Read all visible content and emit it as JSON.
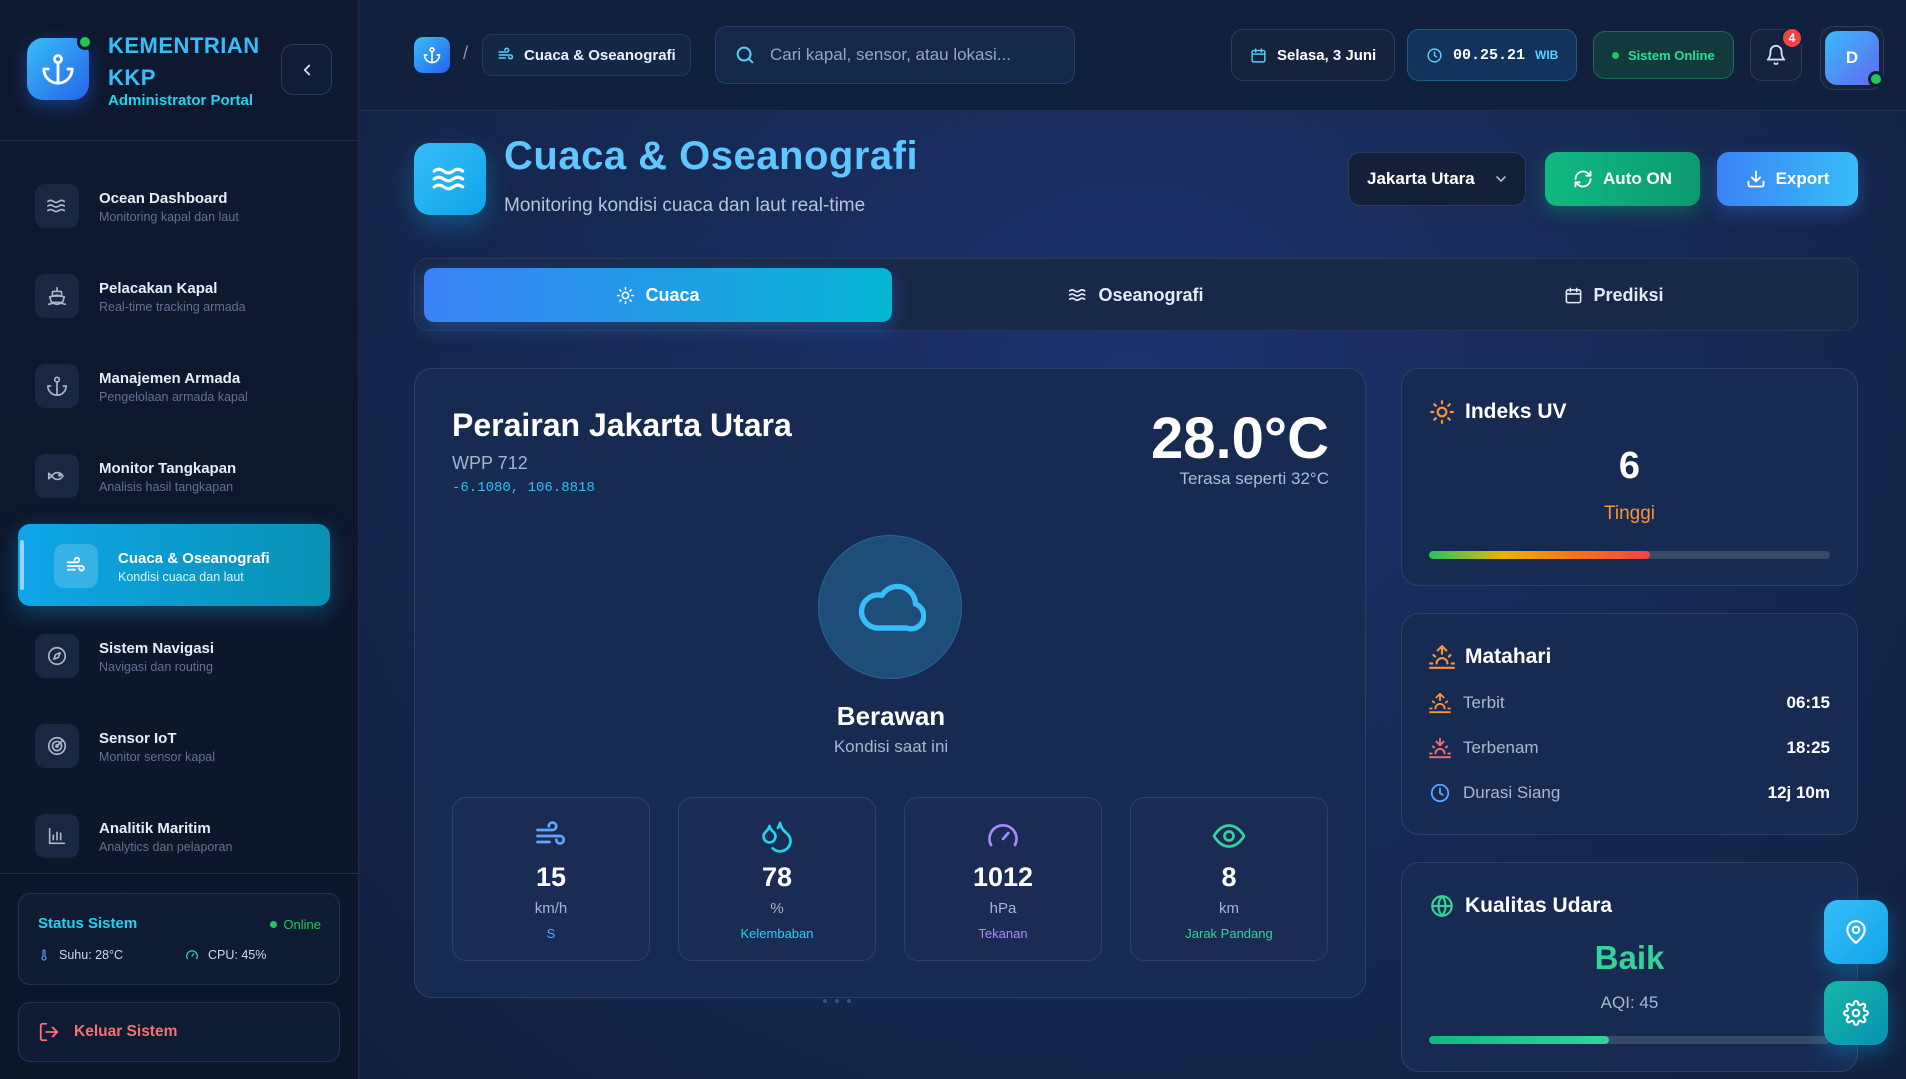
{
  "brand": {
    "name": "KEMENTRIAN KKP",
    "subtitle": "Administrator Portal"
  },
  "sidebar": {
    "items": [
      {
        "title": "Ocean Dashboard",
        "subtitle": "Monitoring kapal dan laut",
        "icon": "waves-icon"
      },
      {
        "title": "Pelacakan Kapal",
        "subtitle": "Real-time tracking armada",
        "icon": "ship-icon"
      },
      {
        "title": "Manajemen Armada",
        "subtitle": "Pengelolaan armada kapal",
        "icon": "anchor-icon"
      },
      {
        "title": "Monitor Tangkapan",
        "subtitle": "Analisis hasil tangkapan",
        "icon": "fish-icon"
      },
      {
        "title": "Cuaca & Oseanografi",
        "subtitle": "Kondisi cuaca dan laut",
        "icon": "wind-icon",
        "active": true
      },
      {
        "title": "Sistem Navigasi",
        "subtitle": "Navigasi dan routing",
        "icon": "compass-icon"
      },
      {
        "title": "Sensor IoT",
        "subtitle": "Monitor sensor kapal",
        "icon": "radar-icon"
      },
      {
        "title": "Analitik Maritim",
        "subtitle": "Analytics dan pelaporan",
        "icon": "bar-chart-icon"
      }
    ],
    "status": {
      "title": "Status Sistem",
      "online": "Online",
      "temp": "Suhu: 28°C",
      "cpu": "CPU: 45%"
    },
    "logout": "Keluar Sistem"
  },
  "topbar": {
    "breadcrumb_sep": "/",
    "breadcrumb_current": "Cuaca & Oseanografi",
    "search_placeholder": "Cari kapal, sensor, atau lokasi...",
    "date": "Selasa, 3 Juni",
    "time": "00.25.21",
    "timezone": "WIB",
    "system_status": "Sistem Online",
    "notifications": "4",
    "avatar_initial": "D"
  },
  "page": {
    "title": "Cuaca & Oseanografi",
    "subtitle": "Monitoring kondisi cuaca dan laut real-time",
    "region": "Jakarta Utara",
    "auto_label": "Auto ON",
    "export_label": "Export"
  },
  "tabs": [
    {
      "label": "Cuaca",
      "icon": "sun-icon",
      "active": true
    },
    {
      "label": "Oseanografi",
      "icon": "waves-icon"
    },
    {
      "label": "Prediksi",
      "icon": "calendar-icon"
    }
  ],
  "weather": {
    "location": "Perairan Jakarta Utara",
    "wpp": "WPP 712",
    "coords": "-6.1080, 106.8818",
    "temperature": "28.0°C",
    "feels_like": "Terasa seperti 32°C",
    "condition": "Berawan",
    "condition_sub": "Kondisi saat ini",
    "metrics": [
      {
        "value": "15",
        "unit": "km/h",
        "label": "S",
        "icon": "wind-icon",
        "color": "#60a5fa"
      },
      {
        "value": "78",
        "unit": "%",
        "label": "Kelembaban",
        "icon": "droplets-icon",
        "color": "#22d3ee"
      },
      {
        "value": "1012",
        "unit": "hPa",
        "label": "Tekanan",
        "icon": "gauge-icon",
        "color": "#a78bfa"
      },
      {
        "value": "8",
        "unit": "km",
        "label": "Jarak Pandang",
        "icon": "eye-icon",
        "color": "#34d399"
      }
    ]
  },
  "uv": {
    "title": "Indeks UV",
    "value": "6",
    "level": "Tinggi",
    "level_fraction": 0.55
  },
  "sun": {
    "title": "Matahari",
    "rows": [
      {
        "label": "Terbit",
        "value": "06:15",
        "icon": "sunrise-icon"
      },
      {
        "label": "Terbenam",
        "value": "18:25",
        "icon": "sunset-icon"
      },
      {
        "label": "Durasi Siang",
        "value": "12j 10m",
        "icon": "clock-icon"
      }
    ]
  },
  "air": {
    "title": "Kualitas Udara",
    "value": "Baik",
    "aqi": "AQI: 45",
    "fraction": 0.45
  },
  "colors": {
    "accent": "#0ea5e9",
    "success": "#10b981",
    "uv_level": "#fb923c",
    "air_good": "#34d399",
    "notify": "#ef4444"
  }
}
